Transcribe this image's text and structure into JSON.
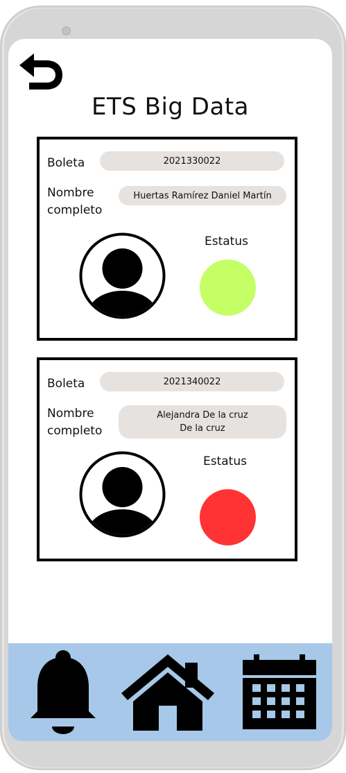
{
  "header": {
    "title": "ETS Big Data",
    "back_icon": "back-arrow-icon"
  },
  "students": [
    {
      "boleta_label": "Boleta",
      "boleta": "2021330022",
      "nombre_label_line1": "Nombre",
      "nombre_label_line2": "completo",
      "nombre_line1": "Huertas Ramírez Daniel Martín",
      "nombre_line2": "",
      "estatus_label": "Estatus",
      "status_color": "#c4ff66",
      "avatar_icon": "user-avatar-icon"
    },
    {
      "boleta_label": "Boleta",
      "boleta": "2021340022",
      "nombre_label_line1": "Nombre",
      "nombre_label_line2": "completo",
      "nombre_line1": "Alejandra De la cruz",
      "nombre_line2": "De la cruz",
      "estatus_label": "Estatus",
      "status_color": "#ff3333",
      "avatar_icon": "user-avatar-icon"
    }
  ],
  "bottom_nav": {
    "items": [
      {
        "icon": "bell-icon"
      },
      {
        "icon": "home-icon"
      },
      {
        "icon": "calendar-icon"
      }
    ],
    "background": "#a7c8e8"
  }
}
